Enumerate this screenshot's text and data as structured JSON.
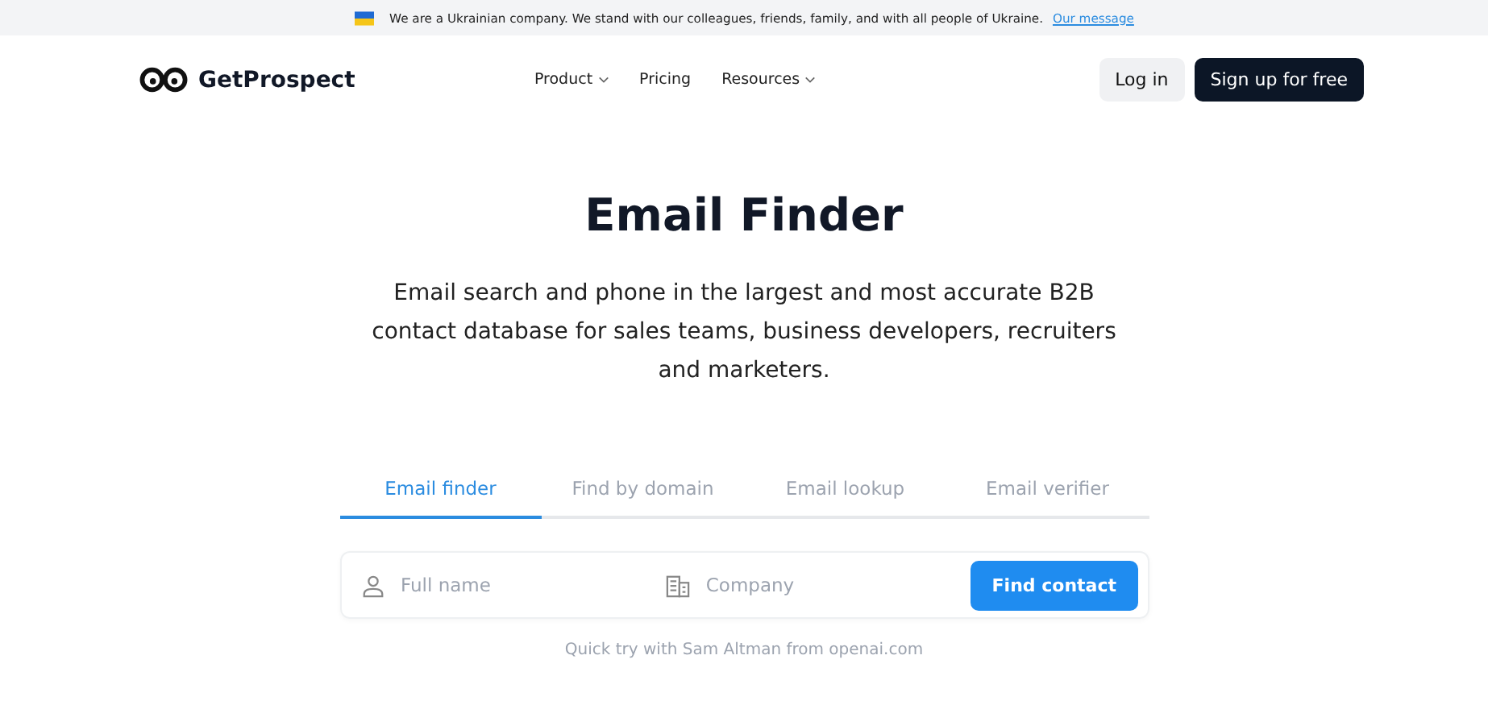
{
  "banner": {
    "text": "We are a Ukrainian company. We stand with our colleagues, friends, family, and with all people of Ukraine.",
    "link": "Our message"
  },
  "header": {
    "logo": "GetProspect",
    "nav": [
      {
        "label": "Product",
        "dropdown": true
      },
      {
        "label": "Pricing",
        "dropdown": false
      },
      {
        "label": "Resources",
        "dropdown": true
      }
    ],
    "login": "Log in",
    "signup": "Sign up for free"
  },
  "hero": {
    "title": "Email Finder",
    "description": "Email search and phone in the largest and most accurate B2B contact database for sales teams, business developers, recruiters and marketers."
  },
  "tabs": [
    {
      "label": "Email finder",
      "selected": true
    },
    {
      "label": "Find by domain",
      "selected": false
    },
    {
      "label": "Email lookup",
      "selected": false
    },
    {
      "label": "Email verifier",
      "selected": false
    }
  ],
  "form": {
    "name_placeholder": "Full name",
    "company_placeholder": "Company",
    "button": "Find contact"
  },
  "hint": "Quick try with Sam Altman from openai.com"
}
